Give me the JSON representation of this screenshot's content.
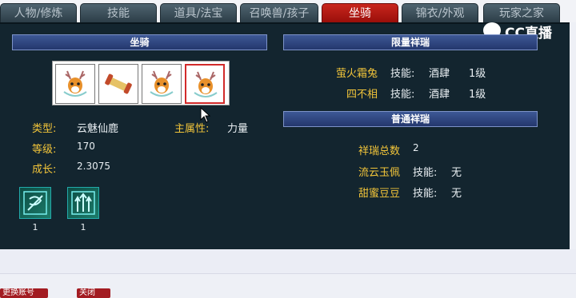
{
  "tabs": [
    {
      "label": "人物/修炼"
    },
    {
      "label": "技能"
    },
    {
      "label": "道具/法宝"
    },
    {
      "label": "召唤兽/孩子"
    },
    {
      "label": "坐骑"
    },
    {
      "label": "锦衣/外观"
    },
    {
      "label": "玩家之家"
    }
  ],
  "watermark": {
    "text": "CC直播"
  },
  "mount_panel": {
    "title": "坐骑",
    "slots": [
      {
        "icon": "deer-mount-icon"
      },
      {
        "icon": "scroll-item-icon"
      },
      {
        "icon": "deer-mount-icon"
      },
      {
        "icon": "deer-mount-icon",
        "selected": true
      }
    ],
    "type_label": "类型:",
    "type_value": "云魅仙鹿",
    "main_attr_label": "主属性:",
    "main_attr_value": "力量",
    "level_label": "等级:",
    "level_value": "170",
    "growth_label": "成长:",
    "growth_value": "2.3075",
    "skills": [
      {
        "icon": "skill-scroll-icon",
        "count": "1"
      },
      {
        "icon": "skill-arrows-icon",
        "count": "1"
      }
    ]
  },
  "limited_panel": {
    "title": "限量祥瑞",
    "items": [
      {
        "name": "萤火霜兔",
        "skill_label": "技能:",
        "skill_value": "酒肆",
        "level": "1级"
      },
      {
        "name": "四不相",
        "skill_label": "技能:",
        "skill_value": "酒肆",
        "level": "1级"
      }
    ]
  },
  "normal_panel": {
    "title": "普通祥瑞",
    "total_label": "祥瑞总数",
    "total_value": "2",
    "items": [
      {
        "name": "流云玉佩",
        "skill_label": "技能:",
        "skill_value": "无"
      },
      {
        "name": "甜蜜豆豆",
        "skill_label": "技能:",
        "skill_value": "无"
      }
    ]
  },
  "bottom_buttons": [
    {
      "label": "更换账号"
    },
    {
      "label": "关闭"
    }
  ],
  "colors": {
    "label_gold": "#f2c53a",
    "panel_bg": "#13252f",
    "active_tab": "#b8160f",
    "title_bar": "#2e4580"
  }
}
